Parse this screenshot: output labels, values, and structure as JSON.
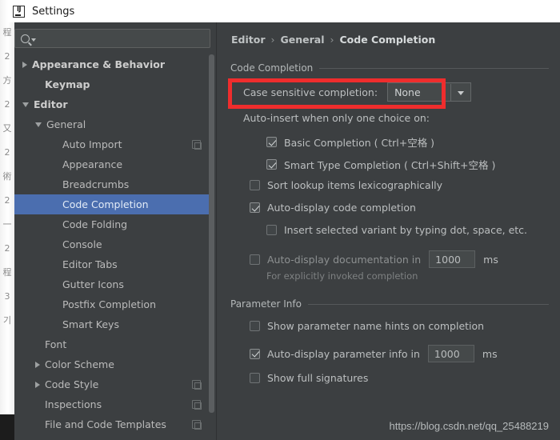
{
  "window": {
    "title": "Settings",
    "app_icon": "intellij-idea-icon"
  },
  "background_page": {
    "glyphs": [
      "程",
      "2",
      "方",
      "2",
      "又",
      "2",
      "術",
      "2",
      "一",
      "2",
      "程",
      "3",
      "기"
    ]
  },
  "sidebar": {
    "search": {
      "value": "",
      "placeholder": "",
      "icon": "search-icon",
      "caret_icon": "chevron-down-icon"
    },
    "items": [
      {
        "label": "Appearance & Behavior",
        "indent": 0,
        "arrow": "right",
        "bold": true,
        "selected": false,
        "copy_icon": false
      },
      {
        "label": "Keymap",
        "indent": 1,
        "arrow": "none",
        "bold": true,
        "selected": false,
        "copy_icon": false
      },
      {
        "label": "Editor",
        "indent": 0,
        "arrow": "down",
        "bold": true,
        "selected": false,
        "copy_icon": false
      },
      {
        "label": "General",
        "indent": 1,
        "arrow": "down",
        "bold": false,
        "selected": false,
        "copy_icon": false
      },
      {
        "label": "Auto Import",
        "indent": 2,
        "arrow": "none",
        "bold": false,
        "selected": false,
        "copy_icon": true
      },
      {
        "label": "Appearance",
        "indent": 2,
        "arrow": "none",
        "bold": false,
        "selected": false,
        "copy_icon": false
      },
      {
        "label": "Breadcrumbs",
        "indent": 2,
        "arrow": "none",
        "bold": false,
        "selected": false,
        "copy_icon": false
      },
      {
        "label": "Code Completion",
        "indent": 2,
        "arrow": "none",
        "bold": false,
        "selected": true,
        "copy_icon": false
      },
      {
        "label": "Code Folding",
        "indent": 2,
        "arrow": "none",
        "bold": false,
        "selected": false,
        "copy_icon": false
      },
      {
        "label": "Console",
        "indent": 2,
        "arrow": "none",
        "bold": false,
        "selected": false,
        "copy_icon": false
      },
      {
        "label": "Editor Tabs",
        "indent": 2,
        "arrow": "none",
        "bold": false,
        "selected": false,
        "copy_icon": false
      },
      {
        "label": "Gutter Icons",
        "indent": 2,
        "arrow": "none",
        "bold": false,
        "selected": false,
        "copy_icon": false
      },
      {
        "label": "Postfix Completion",
        "indent": 2,
        "arrow": "none",
        "bold": false,
        "selected": false,
        "copy_icon": false
      },
      {
        "label": "Smart Keys",
        "indent": 2,
        "arrow": "none",
        "bold": false,
        "selected": false,
        "copy_icon": false
      },
      {
        "label": "Font",
        "indent": 1,
        "arrow": "none",
        "bold": false,
        "selected": false,
        "copy_icon": false
      },
      {
        "label": "Color Scheme",
        "indent": 1,
        "arrow": "right",
        "bold": false,
        "selected": false,
        "copy_icon": false
      },
      {
        "label": "Code Style",
        "indent": 1,
        "arrow": "right",
        "bold": false,
        "selected": false,
        "copy_icon": true
      },
      {
        "label": "Inspections",
        "indent": 1,
        "arrow": "none",
        "bold": false,
        "selected": false,
        "copy_icon": true
      },
      {
        "label": "File and Code Templates",
        "indent": 1,
        "arrow": "none",
        "bold": false,
        "selected": false,
        "copy_icon": true
      }
    ]
  },
  "breadcrumb": {
    "crumbs": [
      "Editor",
      "General",
      "Code Completion"
    ],
    "separator": "›"
  },
  "sections": {
    "code_completion": {
      "title": "Code Completion",
      "case_sensitive_label": "Case sensitive completion:",
      "case_sensitive_value": "None",
      "auto_insert_label": "Auto-insert when only one choice on:",
      "basic_completion": "Basic Completion ( Ctrl+空格 )",
      "smart_type_completion": "Smart Type Completion ( Ctrl+Shift+空格 )",
      "sort_lookup": "Sort lookup items lexicographically",
      "auto_display_code": "Auto-display code completion",
      "insert_selected_variant": "Insert selected variant by typing dot, space, etc.",
      "auto_display_doc": "Auto-display documentation in",
      "auto_display_doc_value": "1000",
      "auto_display_doc_unit": "ms",
      "auto_display_doc_note": "For explicitly invoked completion"
    },
    "parameter_info": {
      "title": "Parameter Info",
      "show_param_hints": "Show parameter name hints on completion",
      "auto_display_param": "Auto-display parameter info in",
      "auto_display_param_value": "1000",
      "auto_display_param_unit": "ms",
      "show_full_signatures": "Show full signatures"
    }
  },
  "watermark": "https://blog.csdn.net/qq_25488219",
  "colors": {
    "panel_bg": "#3c3f41",
    "selection_blue": "#4b6eaf",
    "highlight_red": "#ef2d2d",
    "text": "#bbbbbb"
  }
}
